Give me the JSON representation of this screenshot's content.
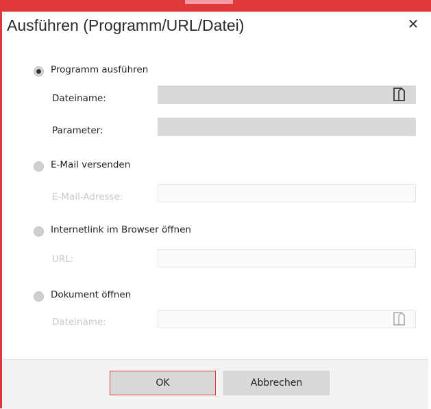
{
  "window": {
    "title": "Ausführen (Programm/URL/Datei)",
    "close_glyph": "✕"
  },
  "options": [
    {
      "label": "Programm ausführen",
      "selected": true,
      "fields": [
        {
          "label": "Dateiname:",
          "value": "",
          "browse_icon": "folder-open-icon"
        },
        {
          "label": "Parameter:",
          "value": ""
        }
      ]
    },
    {
      "label": "E-Mail versenden",
      "selected": false,
      "fields": [
        {
          "label": "E-Mail-Adresse:",
          "value": ""
        }
      ]
    },
    {
      "label": "Internetlink im Browser öffnen",
      "selected": false,
      "fields": [
        {
          "label": "URL:",
          "value": ""
        }
      ]
    },
    {
      "label": "Dokument öffnen",
      "selected": false,
      "fields": [
        {
          "label": "Dateiname:",
          "value": "",
          "browse_icon": "folder-open-icon"
        }
      ]
    }
  ],
  "buttons": {
    "ok": "OK",
    "cancel": "Abbrechen"
  },
  "colors": {
    "accent": "#e0393b",
    "field_bg": "#d9d9d9",
    "disabled_text": "#c8c8c8"
  }
}
